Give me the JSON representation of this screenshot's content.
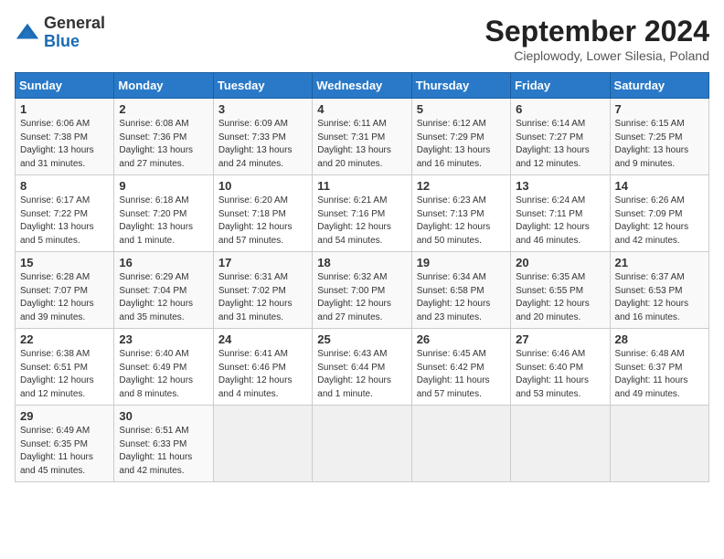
{
  "header": {
    "logo_general": "General",
    "logo_blue": "Blue",
    "month_title": "September 2024",
    "subtitle": "Cieplowody, Lower Silesia, Poland"
  },
  "days_of_week": [
    "Sunday",
    "Monday",
    "Tuesday",
    "Wednesday",
    "Thursday",
    "Friday",
    "Saturday"
  ],
  "weeks": [
    [
      {
        "day": "1",
        "info": "Sunrise: 6:06 AM\nSunset: 7:38 PM\nDaylight: 13 hours\nand 31 minutes."
      },
      {
        "day": "2",
        "info": "Sunrise: 6:08 AM\nSunset: 7:36 PM\nDaylight: 13 hours\nand 27 minutes."
      },
      {
        "day": "3",
        "info": "Sunrise: 6:09 AM\nSunset: 7:33 PM\nDaylight: 13 hours\nand 24 minutes."
      },
      {
        "day": "4",
        "info": "Sunrise: 6:11 AM\nSunset: 7:31 PM\nDaylight: 13 hours\nand 20 minutes."
      },
      {
        "day": "5",
        "info": "Sunrise: 6:12 AM\nSunset: 7:29 PM\nDaylight: 13 hours\nand 16 minutes."
      },
      {
        "day": "6",
        "info": "Sunrise: 6:14 AM\nSunset: 7:27 PM\nDaylight: 13 hours\nand 12 minutes."
      },
      {
        "day": "7",
        "info": "Sunrise: 6:15 AM\nSunset: 7:25 PM\nDaylight: 13 hours\nand 9 minutes."
      }
    ],
    [
      {
        "day": "8",
        "info": "Sunrise: 6:17 AM\nSunset: 7:22 PM\nDaylight: 13 hours\nand 5 minutes."
      },
      {
        "day": "9",
        "info": "Sunrise: 6:18 AM\nSunset: 7:20 PM\nDaylight: 13 hours\nand 1 minute."
      },
      {
        "day": "10",
        "info": "Sunrise: 6:20 AM\nSunset: 7:18 PM\nDaylight: 12 hours\nand 57 minutes."
      },
      {
        "day": "11",
        "info": "Sunrise: 6:21 AM\nSunset: 7:16 PM\nDaylight: 12 hours\nand 54 minutes."
      },
      {
        "day": "12",
        "info": "Sunrise: 6:23 AM\nSunset: 7:13 PM\nDaylight: 12 hours\nand 50 minutes."
      },
      {
        "day": "13",
        "info": "Sunrise: 6:24 AM\nSunset: 7:11 PM\nDaylight: 12 hours\nand 46 minutes."
      },
      {
        "day": "14",
        "info": "Sunrise: 6:26 AM\nSunset: 7:09 PM\nDaylight: 12 hours\nand 42 minutes."
      }
    ],
    [
      {
        "day": "15",
        "info": "Sunrise: 6:28 AM\nSunset: 7:07 PM\nDaylight: 12 hours\nand 39 minutes."
      },
      {
        "day": "16",
        "info": "Sunrise: 6:29 AM\nSunset: 7:04 PM\nDaylight: 12 hours\nand 35 minutes."
      },
      {
        "day": "17",
        "info": "Sunrise: 6:31 AM\nSunset: 7:02 PM\nDaylight: 12 hours\nand 31 minutes."
      },
      {
        "day": "18",
        "info": "Sunrise: 6:32 AM\nSunset: 7:00 PM\nDaylight: 12 hours\nand 27 minutes."
      },
      {
        "day": "19",
        "info": "Sunrise: 6:34 AM\nSunset: 6:58 PM\nDaylight: 12 hours\nand 23 minutes."
      },
      {
        "day": "20",
        "info": "Sunrise: 6:35 AM\nSunset: 6:55 PM\nDaylight: 12 hours\nand 20 minutes."
      },
      {
        "day": "21",
        "info": "Sunrise: 6:37 AM\nSunset: 6:53 PM\nDaylight: 12 hours\nand 16 minutes."
      }
    ],
    [
      {
        "day": "22",
        "info": "Sunrise: 6:38 AM\nSunset: 6:51 PM\nDaylight: 12 hours\nand 12 minutes."
      },
      {
        "day": "23",
        "info": "Sunrise: 6:40 AM\nSunset: 6:49 PM\nDaylight: 12 hours\nand 8 minutes."
      },
      {
        "day": "24",
        "info": "Sunrise: 6:41 AM\nSunset: 6:46 PM\nDaylight: 12 hours\nand 4 minutes."
      },
      {
        "day": "25",
        "info": "Sunrise: 6:43 AM\nSunset: 6:44 PM\nDaylight: 12 hours\nand 1 minute."
      },
      {
        "day": "26",
        "info": "Sunrise: 6:45 AM\nSunset: 6:42 PM\nDaylight: 11 hours\nand 57 minutes."
      },
      {
        "day": "27",
        "info": "Sunrise: 6:46 AM\nSunset: 6:40 PM\nDaylight: 11 hours\nand 53 minutes."
      },
      {
        "day": "28",
        "info": "Sunrise: 6:48 AM\nSunset: 6:37 PM\nDaylight: 11 hours\nand 49 minutes."
      }
    ],
    [
      {
        "day": "29",
        "info": "Sunrise: 6:49 AM\nSunset: 6:35 PM\nDaylight: 11 hours\nand 45 minutes."
      },
      {
        "day": "30",
        "info": "Sunrise: 6:51 AM\nSunset: 6:33 PM\nDaylight: 11 hours\nand 42 minutes."
      },
      {
        "day": "",
        "info": ""
      },
      {
        "day": "",
        "info": ""
      },
      {
        "day": "",
        "info": ""
      },
      {
        "day": "",
        "info": ""
      },
      {
        "day": "",
        "info": ""
      }
    ]
  ]
}
